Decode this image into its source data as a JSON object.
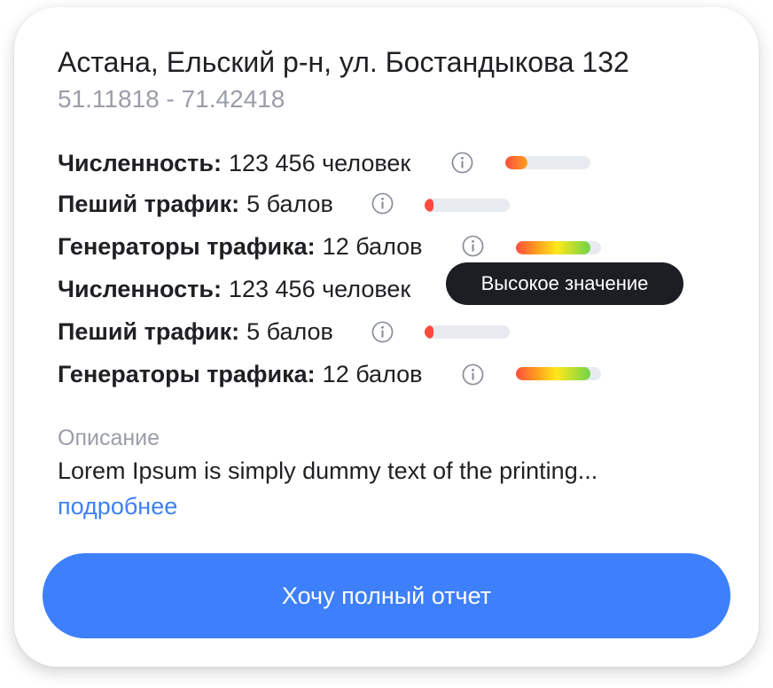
{
  "location": {
    "address": "Астана, Ельский р-н, ул. Бостандыкова 132",
    "coordinates": "51.11818 - 71.42418"
  },
  "metrics": [
    {
      "label": "Численность:",
      "value": "123 456 человек",
      "level": 0.26,
      "style": "orange"
    },
    {
      "label": "Пеший трафик:",
      "value": "5 балов",
      "level": 0.1,
      "style": "red"
    },
    {
      "label": "Генераторы трафика:",
      "value": "12 балов",
      "level": 0.88,
      "style": "gradient"
    },
    {
      "label": "Численность:",
      "value": "123 456 человек",
      "level": null,
      "style": "hidden"
    },
    {
      "label": "Пеший трафик:",
      "value": "5 балов",
      "level": 0.1,
      "style": "red"
    },
    {
      "label": "Генераторы трафика:",
      "value": "12 балов",
      "level": 0.88,
      "style": "gradient"
    }
  ],
  "tooltip": {
    "text": "Высокое значение"
  },
  "description": {
    "label": "Описание",
    "text": "Lorem Ipsum is simply dummy text of the printing...",
    "more_link": "подробнее"
  },
  "cta": {
    "label": "Хочу полный отчет"
  },
  "colors": {
    "accent": "#3e80fb",
    "link": "#3d80f6",
    "tooltip_bg": "#1c1e24",
    "bar_track": "#e7eaee",
    "level_low": "#ff4a3d",
    "level_mid": "#ffe81a",
    "level_high": "#6fd34a"
  },
  "icons": {
    "info": "info-circle-icon"
  }
}
